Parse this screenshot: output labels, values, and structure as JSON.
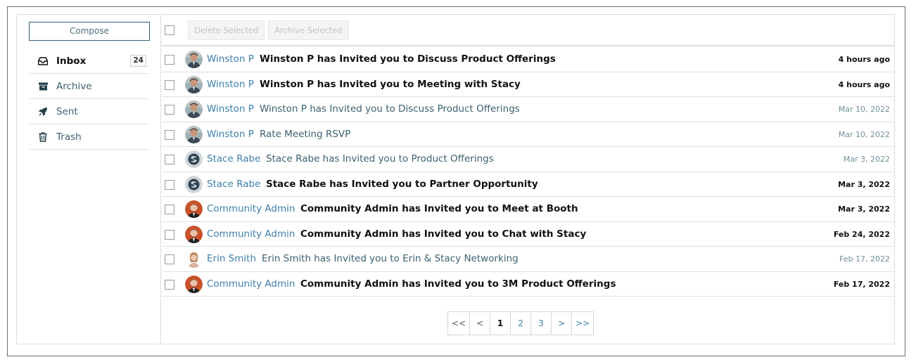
{
  "sidebar": {
    "compose_label": "Compose",
    "items": [
      {
        "label": "Inbox",
        "icon": "inbox-icon",
        "badge": "24",
        "active": true
      },
      {
        "label": "Archive",
        "icon": "archive-icon"
      },
      {
        "label": "Sent",
        "icon": "rocket-icon"
      },
      {
        "label": "Trash",
        "icon": "trash-icon"
      }
    ]
  },
  "toolbar": {
    "delete_label": "Delete Selected",
    "archive_label": "Archive Selected"
  },
  "messages": [
    {
      "sender": "Winston P",
      "subject": "Winston P has Invited you to Discuss Product Offerings",
      "date": "4 hours ago",
      "unread": true,
      "avatar": "photo-winston"
    },
    {
      "sender": "Winston P",
      "subject": "Winston P has Invited you to Meeting with Stacy",
      "date": "4 hours ago",
      "unread": true,
      "avatar": "photo-winston"
    },
    {
      "sender": "Winston P",
      "subject": "Winston P has Invited you to Discuss Product Offerings",
      "date": "Mar 10, 2022",
      "unread": false,
      "avatar": "photo-winston"
    },
    {
      "sender": "Winston P",
      "subject": "Rate Meeting RSVP",
      "date": "Mar 10, 2022",
      "unread": false,
      "avatar": "photo-winston"
    },
    {
      "sender": "Stace Rabe",
      "subject": "Stace Rabe has Invited you to Product Offerings",
      "date": "Mar 3, 2022",
      "unread": false,
      "avatar": "logo-stace"
    },
    {
      "sender": "Stace Rabe",
      "subject": "Stace Rabe has Invited you to Partner Opportunity",
      "date": "Mar 3, 2022",
      "unread": true,
      "avatar": "logo-stace"
    },
    {
      "sender": "Community Admin",
      "subject": "Community Admin has Invited you to Meet at Booth",
      "date": "Mar 3, 2022",
      "unread": true,
      "avatar": "photo-admin"
    },
    {
      "sender": "Community Admin",
      "subject": "Community Admin has Invited you to Chat with Stacy",
      "date": "Feb 24, 2022",
      "unread": true,
      "avatar": "photo-admin"
    },
    {
      "sender": "Erin Smith",
      "subject": "Erin Smith has Invited you to Erin & Stacy Networking",
      "date": "Feb 17, 2022",
      "unread": false,
      "avatar": "photo-erin"
    },
    {
      "sender": "Community Admin",
      "subject": "Community Admin has Invited you to 3M Product Offerings",
      "date": "Feb 17, 2022",
      "unread": true,
      "avatar": "photo-admin"
    }
  ],
  "pagination": {
    "first": "<<",
    "prev": "<",
    "pages": [
      "1",
      "2",
      "3"
    ],
    "current": "1",
    "next": ">",
    "last": ">>"
  },
  "colors": {
    "link": "#3d7fa8",
    "muted_text": "#3a6070",
    "border": "#dcdcdc"
  }
}
